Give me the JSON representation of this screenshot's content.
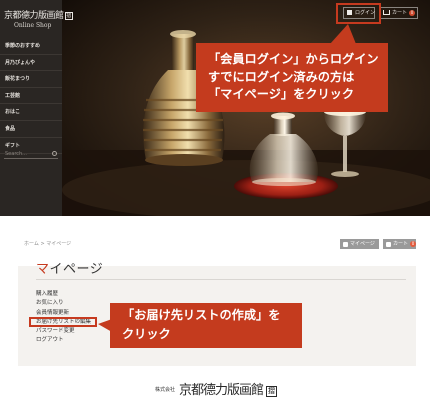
{
  "top": {
    "logo": {
      "brand": "京都德力版画館",
      "seal": "摺",
      "subtitle": "Online Shop"
    },
    "nav": [
      "季節のおすすめ",
      "月乃ぴょんや",
      "飯花まつり",
      "工芸館",
      "おはこ",
      "食品",
      "ギフト"
    ],
    "search": {
      "placeholder": "Search..."
    },
    "header": {
      "login_label": "ログイン",
      "cart_label": "カート",
      "cart_count": "0"
    },
    "callout": [
      "「会員ログイン」からログイン",
      "すでにログイン済みの方は",
      "「マイページ」をクリック"
    ]
  },
  "bottom": {
    "breadcrumb": "ホーム > マイページ",
    "header": {
      "mypage_label": "マイページ",
      "cart_label": "カート",
      "cart_count": "0"
    },
    "title": {
      "first": "マ",
      "rest": "イページ"
    },
    "menu": [
      "購入履歴",
      "お気に入り",
      "会員情報更新",
      "お届け先リストの編集",
      "パスワード変更",
      "ログアウト"
    ],
    "callout": [
      "「お届け先リストの作成」を",
      "クリック"
    ],
    "footer": {
      "corp": "株式会社",
      "brand": "京都德力版画館",
      "seal": "摺"
    }
  },
  "colors": {
    "accent": "#c43b1e",
    "sidebar": "#2a2623",
    "button_gray": "#9a9a9a"
  }
}
